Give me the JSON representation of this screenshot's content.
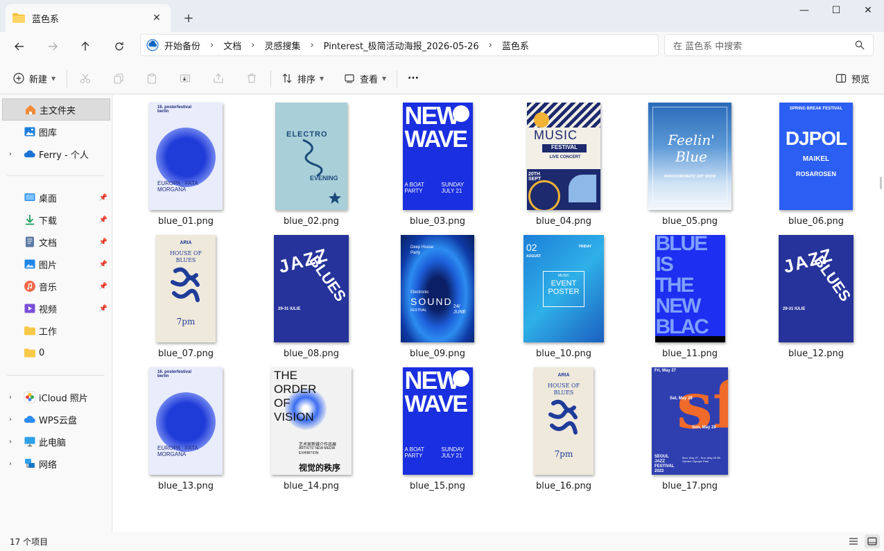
{
  "window": {
    "tab_title": "蓝色系",
    "tab_close": "✕",
    "new_tab": "+",
    "controls": [
      "—",
      "☐",
      "✕"
    ]
  },
  "breadcrumb": [
    "开始备份",
    "文档",
    "灵感搜集",
    "Pinterest_极简活动海报_2026-05-26",
    "蓝色系"
  ],
  "search": {
    "placeholder": "在 蓝色系 中搜索"
  },
  "commands": {
    "new": "新建",
    "sort": "排序",
    "view": "查看",
    "more": "···",
    "preview": "预览"
  },
  "sidebar": {
    "home": "主文件夹",
    "gallery": "图库",
    "personal": "Ferry - 个人",
    "pinned": [
      "桌面",
      "下载",
      "文档",
      "图片",
      "音乐",
      "视频"
    ],
    "folders": [
      "工作",
      "0"
    ],
    "locations": [
      "iCloud 照片",
      "WPS云盘",
      "此电脑",
      "网络"
    ]
  },
  "files": [
    {
      "name": "blue_01.png"
    },
    {
      "name": "blue_02.png"
    },
    {
      "name": "blue_03.png"
    },
    {
      "name": "blue_04.png"
    },
    {
      "name": "blue_05.png"
    },
    {
      "name": "blue_06.png"
    },
    {
      "name": "blue_07.png"
    },
    {
      "name": "blue_08.png"
    },
    {
      "name": "blue_09.png"
    },
    {
      "name": "blue_10.png"
    },
    {
      "name": "blue_11.png"
    },
    {
      "name": "blue_12.png"
    },
    {
      "name": "blue_13.png"
    },
    {
      "name": "blue_14.png"
    },
    {
      "name": "blue_15.png"
    },
    {
      "name": "blue_16.png"
    },
    {
      "name": "blue_17.png"
    }
  ],
  "poster_text": {
    "p01": {
      "top": "16. posterfestival berlin",
      "bottom": "EUROPA_ FATA MORGANA"
    },
    "p02": {
      "main": "ELECTRO",
      "sub": "EVENING"
    },
    "p03": {
      "main1": "NEW",
      "main2": "WAVE",
      "left": "A BOAT PARTY",
      "right": "SUNDAY JULY 21"
    },
    "p04": {
      "main": "MUSIC",
      "band": "FESTIVAL",
      "sub": "LIVE CONCERT",
      "date": "20TH SEPT"
    },
    "p05": {
      "main": "Feelin' Blue",
      "sub": "MONOCHROMATIC ART SHOW"
    },
    "p06": {
      "top": "SPRING BREAK FESTIVAL",
      "main": "DJPOL",
      "name1": "MAIKEL",
      "name2": "ROSAROSEN"
    },
    "p07": {
      "brand": "ARIA",
      "title": "HOUSE OF BLUES",
      "time": "7pm"
    },
    "p08": {
      "main1": "JAZZ",
      "main2": "BLUES",
      "date": "29-31 IULIE"
    },
    "p09": {
      "top": "Deep House Party",
      "main1": "Electronic",
      "main2": "SOUND",
      "sub": "FESTIVAL",
      "date": "24/ JUNE"
    },
    "p10": {
      "date": "02",
      "month": "AUGUST",
      "day": "FRIDAY",
      "label": "MUSIC",
      "main": "EVENT POSTER"
    },
    "p11": {
      "lines": [
        "BLUE",
        "IS",
        "THE",
        "NEW",
        "BLAC"
      ]
    },
    "p12": {
      "main1": "JAZZ",
      "main2": "BLUES",
      "date": "29-31 IULIE"
    },
    "p13": {
      "top": "16. posterfestival berlin",
      "bottom": "EUROPA_ FATA MORGANA"
    },
    "p14": {
      "main": "THE ORDER OF VISION",
      "cn1": "艺术家新媒介作品展",
      "en": "ARTISTS' NEW MEDIA EXHIBITION",
      "cn2": "视觉的秩序"
    },
    "p15": {
      "main1": "NEW",
      "main2": "WAVE",
      "left": "A BOAT PARTY",
      "right": "SUNDAY JULY 21"
    },
    "p16": {
      "brand": "ARIA",
      "title": "HOUSE OF BLUES",
      "time": "7pm"
    },
    "p17": {
      "d1": "Fri, May 27",
      "d2": "Sat, May 28",
      "d3": "Sun, May 29",
      "bottom": "SEOUL JAZZ FESTIVAL 2022",
      "venue": "Mon, May 27 - Sun, May 29 88 Garden Olympic Park"
    }
  },
  "status": {
    "count": "17 个项目"
  },
  "colors": {
    "accent": "#0067c0",
    "poster_blue": "#1a2fe0",
    "poster_navy": "#26339a",
    "poster_orange": "#f06a2a"
  }
}
